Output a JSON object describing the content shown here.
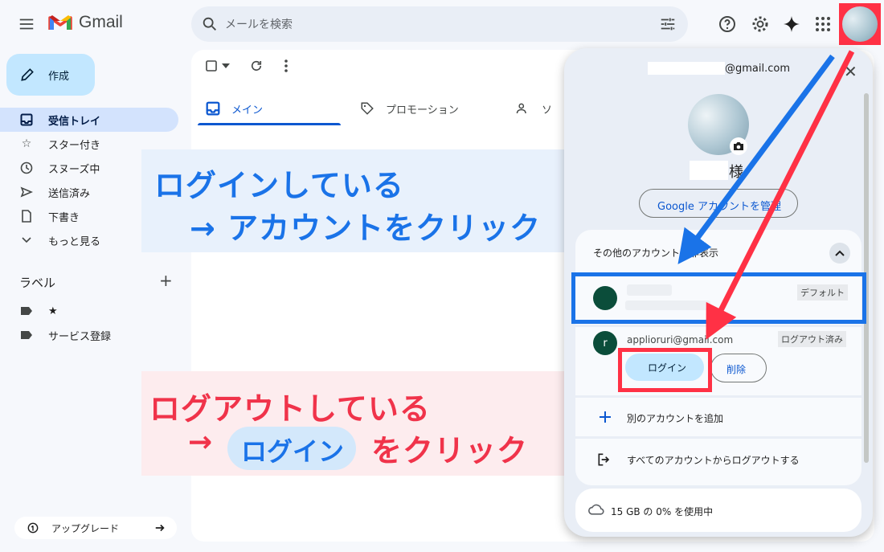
{
  "header": {
    "app_name": "Gmail",
    "search_placeholder": "メールを検索"
  },
  "sidebar": {
    "compose_label": "作成",
    "items": [
      {
        "label": "受信トレイ",
        "icon": "inbox-icon",
        "active": true
      },
      {
        "label": "スター付き",
        "icon": "star-icon"
      },
      {
        "label": "スヌーズ中",
        "icon": "clock-icon"
      },
      {
        "label": "送信済み",
        "icon": "send-icon"
      },
      {
        "label": "下書き",
        "icon": "draft-icon"
      },
      {
        "label": "もっと見る",
        "icon": "chevron-down-icon"
      }
    ],
    "labels_title": "ラベル",
    "labels": [
      {
        "label": "★"
      },
      {
        "label": "サービス登録"
      }
    ],
    "upgrade_label": "アップグレード"
  },
  "main": {
    "tabs": [
      {
        "label": "メイン",
        "active": true
      },
      {
        "label": "プロモーション"
      },
      {
        "label": "ソ"
      }
    ]
  },
  "annotations": {
    "blue_line1": "ログインしている",
    "blue_line2": "→ アカウントをクリック",
    "red_line1": "ログアウトしている",
    "red_arrow": "→",
    "red_pill": "ログイン",
    "red_line2": "をクリック"
  },
  "account_panel": {
    "email_suffix": "@gmail.com",
    "name_suffix": "様",
    "manage_button": "Google アカウントを管理",
    "other_accounts_title": "その他のアカウントを非表示",
    "accounts": [
      {
        "avatar_letter": "",
        "badge": "デフォルト"
      },
      {
        "avatar_letter": "r",
        "email": "applioruri@gmail.com",
        "badge": "ログアウト済み"
      }
    ],
    "login_button": "ログイン",
    "delete_button": "削除",
    "add_account": "別のアカウントを追加",
    "logout_all": "すべてのアカウントからログアウトする",
    "storage": "15 GB の 0% を使用中"
  },
  "colors": {
    "accent_blue": "#1a73e8",
    "accent_red": "#ff3145",
    "compose_bg": "#c2e7ff",
    "active_nav_bg": "#d3e3fd"
  }
}
